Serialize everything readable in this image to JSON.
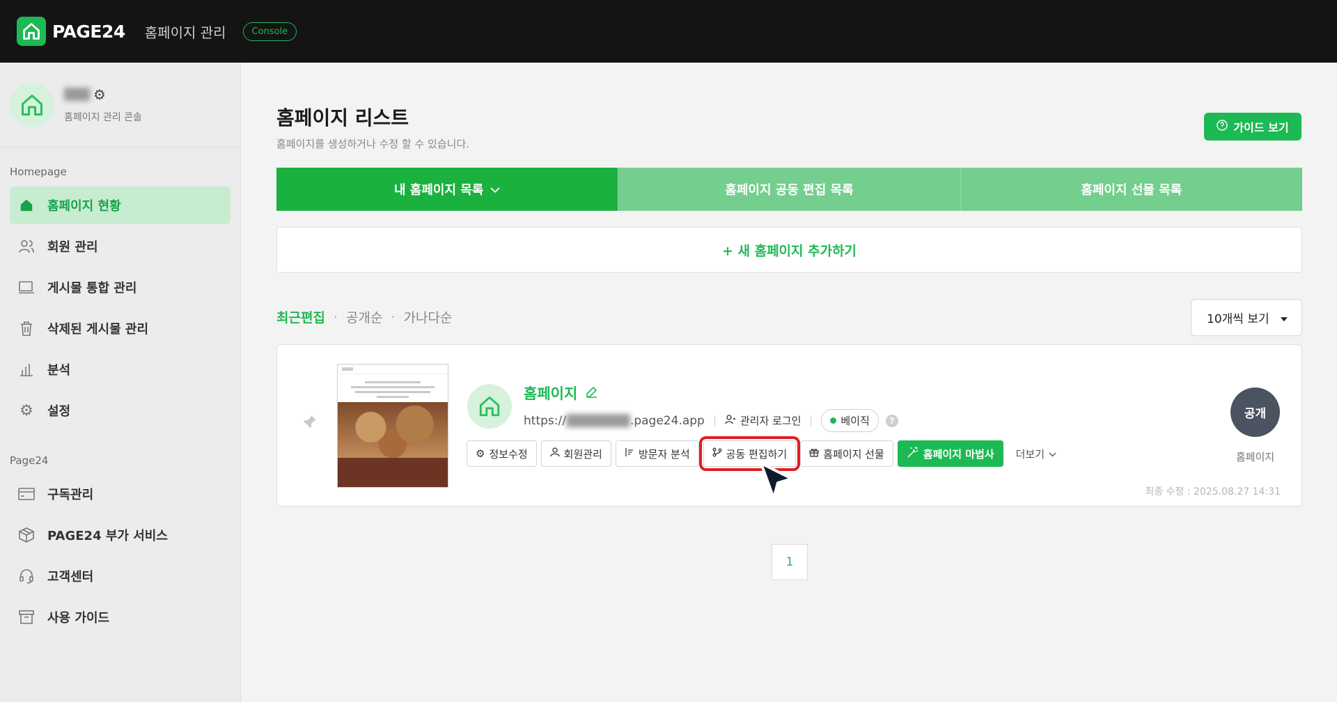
{
  "topbar": {
    "logo_text": "PAGE24",
    "title": "홈페이지 관리",
    "badge": "Console"
  },
  "profile": {
    "name": "███",
    "subtitle": "홈페이지 관리 콘솔"
  },
  "sidebar": {
    "section1": "Homepage",
    "items1": [
      {
        "label": "홈페이지 현황",
        "icon": "home-icon",
        "active": true
      },
      {
        "label": "회원 관리",
        "icon": "users-icon"
      },
      {
        "label": "게시물 통합 관리",
        "icon": "monitor-icon"
      },
      {
        "label": "삭제된 게시물 관리",
        "icon": "trash-icon"
      },
      {
        "label": "분석",
        "icon": "bar-chart-icon"
      },
      {
        "label": "설정",
        "icon": "gear-icon"
      }
    ],
    "section2": "Page24",
    "items2": [
      {
        "label": "구독관리",
        "icon": "card-icon"
      },
      {
        "label": "PAGE24 부가 서비스",
        "icon": "box-icon"
      },
      {
        "label": "고객센터",
        "icon": "headset-icon"
      },
      {
        "label": "사용 가이드",
        "icon": "archive-icon"
      }
    ]
  },
  "main": {
    "title": "홈페이지 리스트",
    "subtitle": "홈페이지를 생성하거나 수정 할 수 있습니다.",
    "guide_button": "가이드 보기",
    "tabs": [
      "내 홈페이지 목록",
      "홈페이지 공동 편집 목록",
      "홈페이지 선물 목록"
    ],
    "add_new": "+ 새 홈페이지 추가하기",
    "sort": [
      "최근편집",
      "공개순",
      "가나다순"
    ],
    "per_page": "10개씩 보기",
    "page": "1"
  },
  "card": {
    "name": "홈페이지",
    "url_prefix": "https://",
    "url_hidden": "████████",
    "url_suffix": ".page24.app",
    "admin_login": "관리자 로그인",
    "plan": "베이직",
    "help": "?",
    "actions": [
      "정보수정",
      "회원관리",
      "방문자 분석",
      "공동 편집하기",
      "홈페이지 선물",
      "홈페이지 마법사"
    ],
    "more": "더보기",
    "status": "공개",
    "status_label": "홈페이지",
    "modified": "최종 수정 : 2025.08.27 14:31"
  },
  "colors": {
    "brand": "#1db954",
    "highlight": "#e11d1d",
    "topbar": "#141414"
  }
}
